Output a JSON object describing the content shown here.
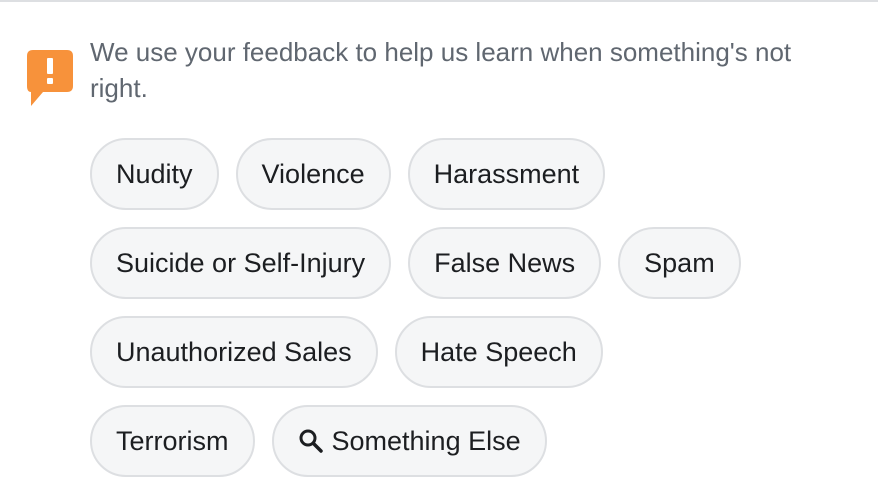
{
  "feedback": {
    "icon": "feedback-alert-icon",
    "icon_color": "#f7923b",
    "message": "We use your feedback to help us learn when something's not right."
  },
  "chips": {
    "rows": [
      [
        {
          "label": "Nudity"
        },
        {
          "label": "Violence"
        },
        {
          "label": "Harassment"
        }
      ],
      [
        {
          "label": "Suicide or Self-Injury"
        },
        {
          "label": "False News"
        },
        {
          "label": "Spam"
        }
      ],
      [
        {
          "label": "Unauthorized Sales"
        },
        {
          "label": "Hate Speech"
        }
      ],
      [
        {
          "label": "Terrorism"
        },
        {
          "label": "Something Else",
          "icon": "search-icon"
        }
      ]
    ]
  }
}
